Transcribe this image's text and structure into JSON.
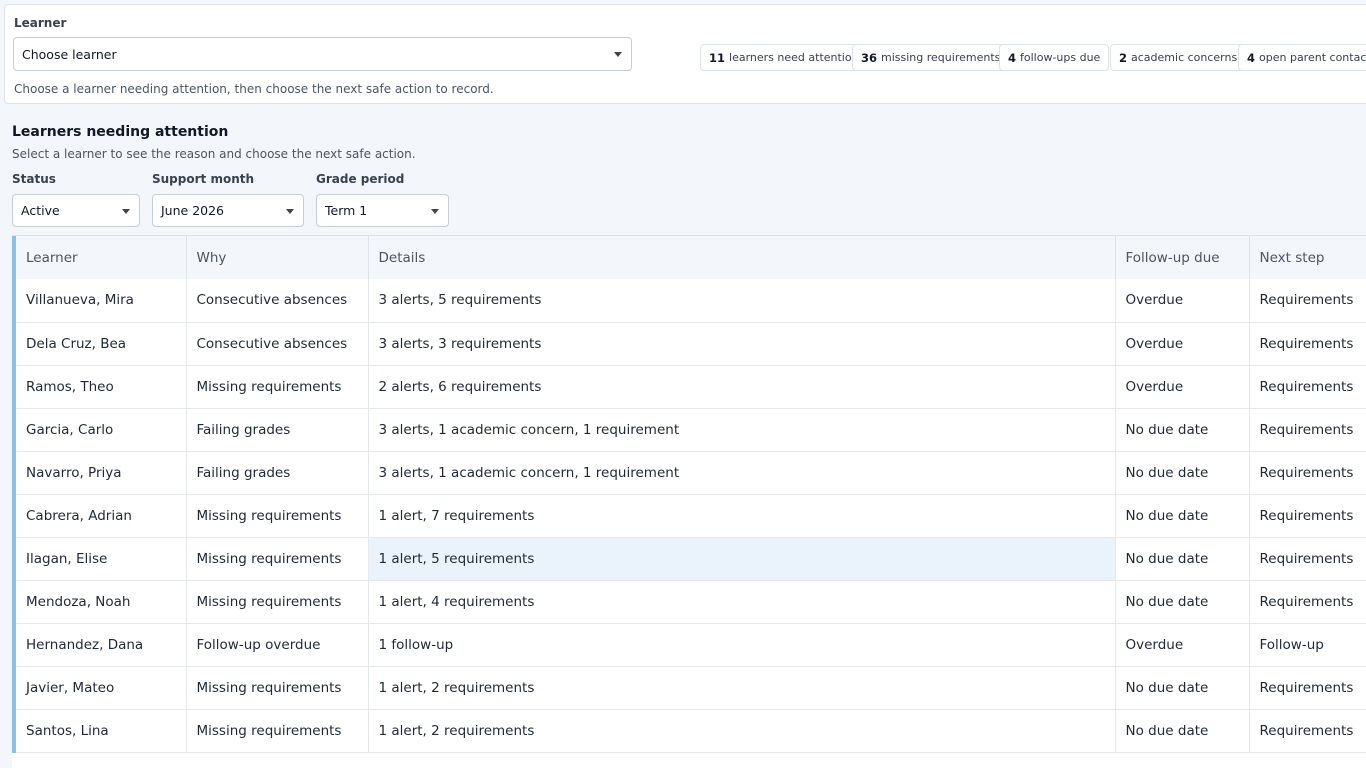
{
  "learner_picker": {
    "label": "Learner",
    "value": "Choose learner",
    "hint": "Choose a learner needing attention, then choose the next safe action to record."
  },
  "summary": [
    {
      "count": "11",
      "label": "learners need attention"
    },
    {
      "count": "36",
      "label": "missing requirements"
    },
    {
      "count": "4",
      "label": "follow-ups due"
    },
    {
      "count": "2",
      "label": "academic concerns"
    },
    {
      "count": "4",
      "label": "open parent contacts"
    }
  ],
  "section": {
    "title": "Learners needing attention",
    "subtitle": "Select a learner to see the reason and choose the next safe action."
  },
  "filters": {
    "status": {
      "label": "Status",
      "value": "Active"
    },
    "month": {
      "label": "Support month",
      "value": "June 2026"
    },
    "period": {
      "label": "Grade period",
      "value": "Term 1"
    }
  },
  "table": {
    "headers": [
      "Learner",
      "Why",
      "Details",
      "Follow-up due",
      "Next step"
    ],
    "rows": [
      [
        "Villanueva, Mira",
        "Consecutive absences",
        "3 alerts, 5 requirements",
        "Overdue",
        "Requirements"
      ],
      [
        "Dela Cruz, Bea",
        "Consecutive absences",
        "3 alerts, 3 requirements",
        "Overdue",
        "Requirements"
      ],
      [
        "Ramos, Theo",
        "Missing requirements",
        "2 alerts, 6 requirements",
        "Overdue",
        "Requirements"
      ],
      [
        "Garcia, Carlo",
        "Failing grades",
        "3 alerts, 1 academic concern, 1 requirement",
        "No due date",
        "Requirements"
      ],
      [
        "Navarro, Priya",
        "Failing grades",
        "3 alerts, 1 academic concern, 1 requirement",
        "No due date",
        "Requirements"
      ],
      [
        "Cabrera, Adrian",
        "Missing requirements",
        "1 alert, 7 requirements",
        "No due date",
        "Requirements"
      ],
      [
        "Ilagan, Elise",
        "Missing requirements",
        "1 alert, 5 requirements",
        "No due date",
        "Requirements"
      ],
      [
        "Mendoza, Noah",
        "Missing requirements",
        "1 alert, 4 requirements",
        "No due date",
        "Requirements"
      ],
      [
        "Hernandez, Dana",
        "Follow-up overdue",
        "1 follow-up",
        "Overdue",
        "Follow-up"
      ],
      [
        "Javier, Mateo",
        "Missing requirements",
        "1 alert, 2 requirements",
        "No due date",
        "Requirements"
      ],
      [
        "Santos, Lina",
        "Missing requirements",
        "1 alert, 2 requirements",
        "No due date",
        "Requirements"
      ]
    ]
  },
  "colors": {
    "accent_bar": "#8ec0e6",
    "row_highlight": "#eaf3fc"
  }
}
